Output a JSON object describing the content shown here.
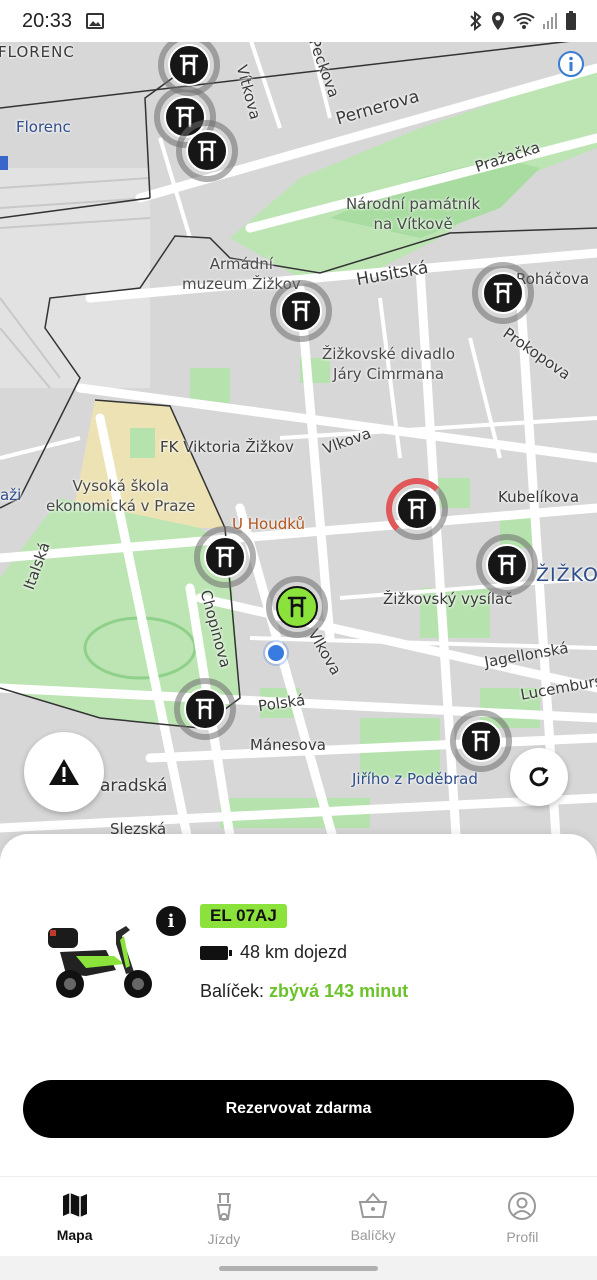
{
  "status_bar": {
    "time": "20:33",
    "left_icons": [
      "image-icon"
    ],
    "right_icons": [
      "bluetooth-icon",
      "location-pin-icon",
      "wifi-icon",
      "signal-icon",
      "battery-icon"
    ]
  },
  "map": {
    "labels": {
      "florenc_area": "FLORENC",
      "florenc_station": "Florenc",
      "vitkova": "Vítkova",
      "peckova": "Peckova",
      "pernerova": "Pernerova",
      "prazacka": "Pražačka",
      "narodni_pamatnik": "Národní památník\nna Vítkově",
      "armadni_muzeum": "Armádní\nmuzeum Žižkov",
      "husitska": "Husitská",
      "rohacova": "Roháčova",
      "prokopova": "Prokopova",
      "divadlo": "Žižkovské divadlo\nJáry Cimrmana",
      "fk_viktoria": "FK Viktoria Žižkov",
      "vlkova": "Vlkova",
      "vse": "Vysoká škola\nekonomická v Praze",
      "u_houdku": "U Houdků",
      "kubelikova": "Kubelíkova",
      "zizkov": "ŽIŽKO",
      "italska": "Italská",
      "chopinova": "Chopinova",
      "vlkova2": "Vlkova",
      "vysilac": "Žižkovský vysílač",
      "jagellonska": "Jagellonská",
      "lucemburska": "Lucembursk",
      "polska": "Polská",
      "manesova": "Mánesova",
      "jiriho": "Jiřího z Poděbrad",
      "vinohradska": "aradská",
      "slezska": "Slezská",
      "bazi": "aži"
    }
  },
  "fabs": {
    "warning_icon": "warning-icon",
    "refresh_icon": "refresh-icon",
    "info_icon": "info-icon"
  },
  "vehicle": {
    "plate": "EL 07AJ",
    "range": "48 km dojezd",
    "package_label": "Balíček:",
    "package_value": "zbývá 143 minut",
    "info_icon": "i"
  },
  "reserve_button": "Rezervovat zdarma",
  "nav": {
    "items": [
      {
        "label": "Mapa",
        "icon": "map-icon",
        "active": true
      },
      {
        "label": "Jízdy",
        "icon": "scooter-icon",
        "active": false
      },
      {
        "label": "Balíčky",
        "icon": "basket-icon",
        "active": false
      },
      {
        "label": "Profil",
        "icon": "profile-icon",
        "active": false
      }
    ]
  },
  "colors": {
    "accent": "#8ae23a",
    "accent_text": "#6cc22a",
    "marker": "#161616",
    "low_battery": "#e0585a"
  }
}
